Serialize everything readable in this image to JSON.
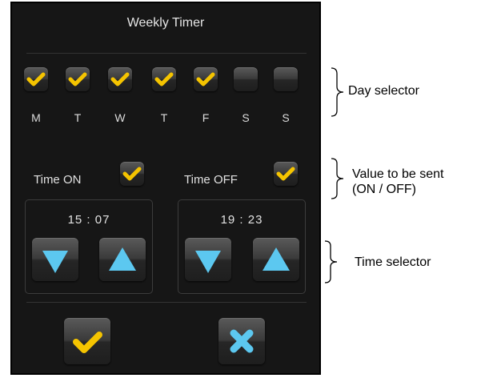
{
  "window": {
    "title": "Weekly Timer"
  },
  "days": [
    {
      "letter": "M",
      "checked": true
    },
    {
      "letter": "T",
      "checked": true
    },
    {
      "letter": "W",
      "checked": true
    },
    {
      "letter": "T",
      "checked": true
    },
    {
      "letter": "F",
      "checked": true
    },
    {
      "letter": "S",
      "checked": false
    },
    {
      "letter": "S",
      "checked": false
    }
  ],
  "time_on": {
    "label": "Time ON",
    "checked": true,
    "value": "15 : 07"
  },
  "time_off": {
    "label": "Time OFF",
    "checked": true,
    "value": "19 : 23"
  },
  "buttons": {
    "confirm_icon": "checkmark-icon",
    "cancel_icon": "x-icon",
    "down_icon": "triangle-down-icon",
    "up_icon": "triangle-up-icon"
  },
  "annotations": {
    "day_selector": "Day selector",
    "value_line1": "Value to be sent",
    "value_line2": "(ON / OFF)",
    "time_selector": "Time selector"
  },
  "colors": {
    "check": "#f5c400",
    "arrow": "#5cc8f0",
    "panel": "#161616"
  }
}
